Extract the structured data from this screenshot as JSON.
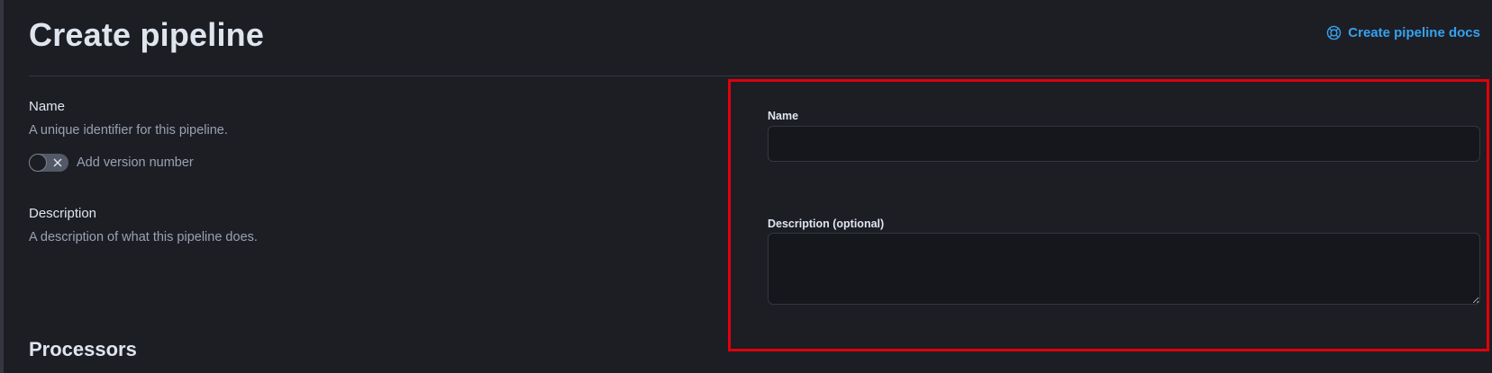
{
  "header": {
    "title": "Create pipeline",
    "docs_link": {
      "label": "Create pipeline docs",
      "icon": "lifebuoy-icon",
      "color": "#36a2ef"
    }
  },
  "left": {
    "name_section": {
      "title": "Name",
      "description": "A unique identifier for this pipeline.",
      "version_toggle": {
        "label": "Add version number",
        "checked": false
      }
    },
    "description_section": {
      "title": "Description",
      "description": "A description of what this pipeline does."
    },
    "processors_title": "Processors"
  },
  "form": {
    "name_field": {
      "label": "Name",
      "value": "",
      "placeholder": ""
    },
    "description_field": {
      "label": "Description (optional)",
      "value": "",
      "placeholder": ""
    }
  },
  "colors": {
    "background": "#1d1e24",
    "input_background": "#16171c",
    "highlight_border": "#e0000b",
    "link": "#36a2ef"
  }
}
